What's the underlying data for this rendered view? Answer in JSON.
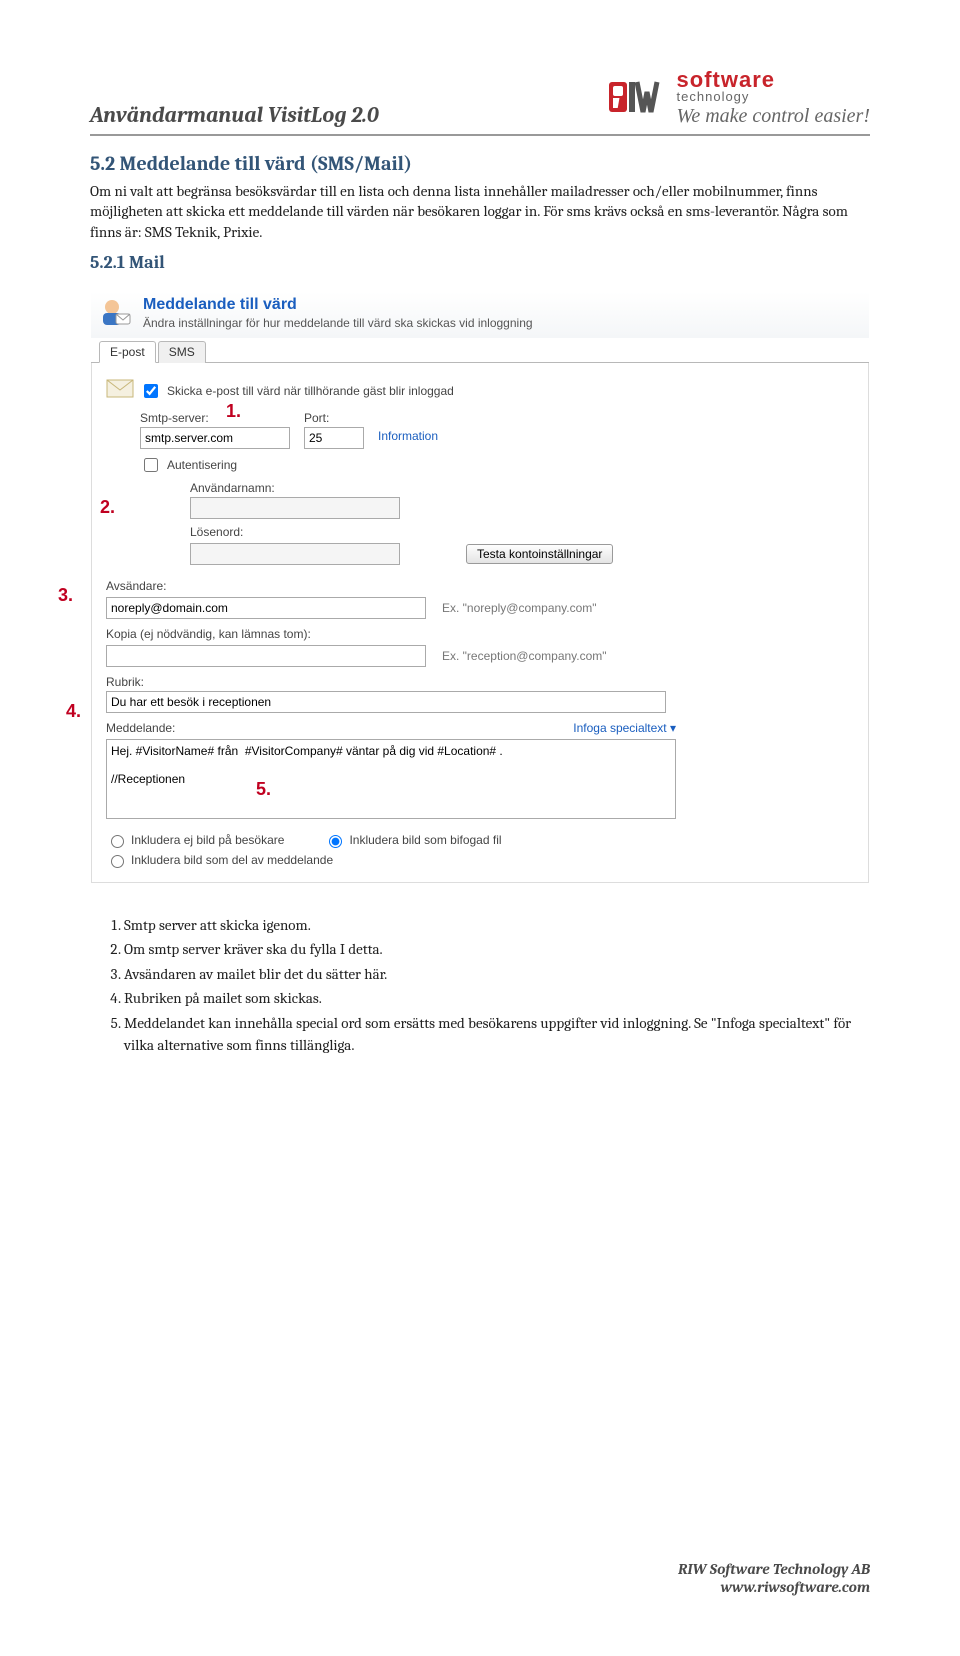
{
  "header": {
    "title": "Användarmanual VisitLog 2.0",
    "logo_line1": "software",
    "logo_line2": "technology",
    "logo_tagline": "We make control easier!"
  },
  "section": {
    "heading": "5.2  Meddelande till värd (SMS/Mail)",
    "body": "Om ni valt att begränsa besöksvärdar till en lista och denna lista innehåller mailadresser och/eller mobilnummer, finns möjligheten att skicka ett meddelande till värden när besökaren loggar in. För sms krävs också en sms-leverantör. Några som finns är: SMS Teknik, Prixie.",
    "subheading": "5.2.1  Mail"
  },
  "ui": {
    "title": "Meddelande till värd",
    "subtitle": "Ändra inställningar för hur meddelande till värd ska skickas vid inloggning",
    "tabs": {
      "epost": "E-post",
      "sms": "SMS"
    },
    "checkbox_send": "Skicka e-post till värd när tillhörande gäst blir inloggad",
    "smtp_label": "Smtp-server:",
    "smtp_value": "smtp.server.com",
    "port_label": "Port:",
    "port_value": "25",
    "info_link": "Information",
    "auth_checkbox": "Autentisering",
    "user_label": "Användarnamn:",
    "user_value": "",
    "pass_label": "Lösenord:",
    "pass_value": "",
    "test_btn": "Testa kontoinställningar",
    "sender_label": "Avsändare:",
    "sender_value": "noreply@domain.com",
    "sender_hint": "Ex. \"noreply@company.com\"",
    "copy_label": "Kopia (ej nödvändig, kan lämnas tom):",
    "copy_value": "",
    "copy_hint": "Ex. \"reception@company.com\"",
    "subject_label": "Rubrik:",
    "subject_value": "Du har ett besök i receptionen",
    "message_label": "Meddelande:",
    "insert_link": "Infoga specialtext ▾",
    "message_value": "Hej. #VisitorName# från  #VisitorCompany# väntar på dig vid #Location# .\n\n//Receptionen",
    "radio1": "Inkludera ej bild på besökare",
    "radio2": "Inkludera bild som bifogad fil",
    "radio3": "Inkludera bild som del av meddelande"
  },
  "callouts": {
    "c1": "1.",
    "c2": "2.",
    "c3": "3.",
    "c4": "4.",
    "c5": "5."
  },
  "list_items": [
    "Smtp server att skicka igenom.",
    "Om smtp server kräver ska du fylla I detta.",
    "Avsändaren av mailet blir det du sätter här.",
    "Rubriken på mailet som skickas.",
    "Meddelandet kan innehålla special ord som ersätts med besökarens uppgifter vid inloggning. Se \"Infoga specialtext\" för vilka alternative som finns tillängliga."
  ],
  "footer": {
    "line1": "RIW Software Technology AB",
    "line2": "www.riwsoftware.com"
  }
}
